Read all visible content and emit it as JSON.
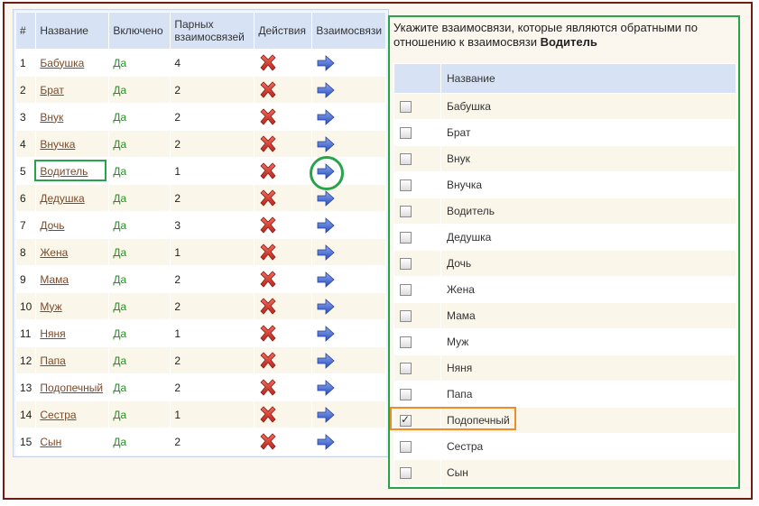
{
  "left_table": {
    "headers": [
      "#",
      "Название",
      "Включено",
      "Парных взаимосвязей",
      "Действия",
      "Взаимосвязи"
    ],
    "rows": [
      {
        "num": "1",
        "name": "Бабушка",
        "enabled": "Да",
        "paired": "4"
      },
      {
        "num": "2",
        "name": "Брат",
        "enabled": "Да",
        "paired": "2"
      },
      {
        "num": "3",
        "name": "Внук",
        "enabled": "Да",
        "paired": "2"
      },
      {
        "num": "4",
        "name": "Внучка",
        "enabled": "Да",
        "paired": "2"
      },
      {
        "num": "5",
        "name": "Водитель",
        "enabled": "Да",
        "paired": "1"
      },
      {
        "num": "6",
        "name": "Дедушка",
        "enabled": "Да",
        "paired": "2"
      },
      {
        "num": "7",
        "name": "Дочь",
        "enabled": "Да",
        "paired": "3"
      },
      {
        "num": "8",
        "name": "Жена",
        "enabled": "Да",
        "paired": "1"
      },
      {
        "num": "9",
        "name": "Мама",
        "enabled": "Да",
        "paired": "2"
      },
      {
        "num": "10",
        "name": "Муж",
        "enabled": "Да",
        "paired": "2"
      },
      {
        "num": "11",
        "name": "Няня",
        "enabled": "Да",
        "paired": "1"
      },
      {
        "num": "12",
        "name": "Папа",
        "enabled": "Да",
        "paired": "2"
      },
      {
        "num": "13",
        "name": "Подопечный",
        "enabled": "Да",
        "paired": "2"
      },
      {
        "num": "14",
        "name": "Сестра",
        "enabled": "Да",
        "paired": "1"
      },
      {
        "num": "15",
        "name": "Сын",
        "enabled": "Да",
        "paired": "2"
      }
    ]
  },
  "right_panel": {
    "instruction": "Укажите взаимосвязи, которые являются обратными по отношению к взаимосвязи",
    "selected": "Водитель",
    "header": "Название",
    "items": [
      {
        "label": "Бабушка",
        "checked": false
      },
      {
        "label": "Брат",
        "checked": false
      },
      {
        "label": "Внук",
        "checked": false
      },
      {
        "label": "Внучка",
        "checked": false
      },
      {
        "label": "Водитель",
        "checked": false
      },
      {
        "label": "Дедушка",
        "checked": false
      },
      {
        "label": "Дочь",
        "checked": false
      },
      {
        "label": "Жена",
        "checked": false
      },
      {
        "label": "Мама",
        "checked": false
      },
      {
        "label": "Муж",
        "checked": false
      },
      {
        "label": "Няня",
        "checked": false
      },
      {
        "label": "Папа",
        "checked": false
      },
      {
        "label": "Подопечный",
        "checked": true
      },
      {
        "label": "Сестра",
        "checked": false
      },
      {
        "label": "Сын",
        "checked": false
      }
    ]
  },
  "icons": {
    "delete": "delete-x-icon",
    "relations": "arrow-right-icon"
  },
  "colors": {
    "highlight_green": "#27a34a",
    "highlight_orange": "#f28a28",
    "frame": "#6d1e12",
    "link": "#7a4a2a",
    "yes": "#2a8a2a"
  }
}
